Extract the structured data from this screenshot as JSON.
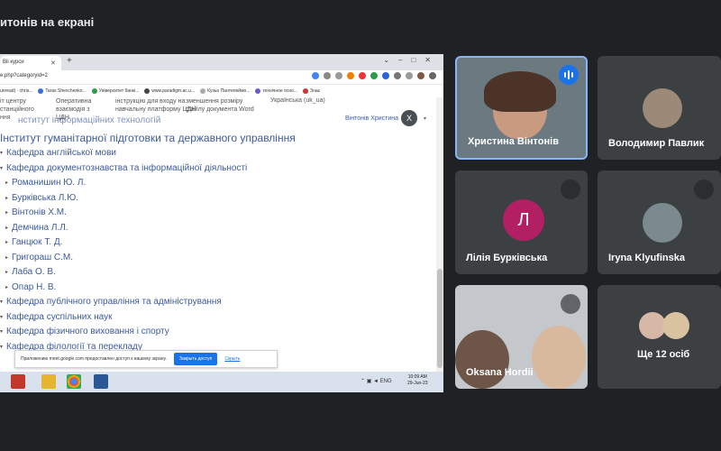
{
  "meeting": {
    "presenter_title": "итонів на екрані"
  },
  "shared_screen": {
    "browser": {
      "tab_title": "Віі курси",
      "url": "e.php?categoryid=2",
      "bookmarks": [
        "unread) · chris...",
        "Taras Shevchenko...",
        "Університет банкі...",
        "www.paradigm.ac.u...",
        "Кузьо Пантелеймо...",
        "технічное осно...",
        "Знає"
      ]
    },
    "page": {
      "overlap_lines": [
        [
          "іт центру",
          "станційного",
          "ння"
        ],
        [
          "Оперативна",
          "взаємодія з",
          "ЦДН"
        ],
        [
          "інструкцію для входу на",
          "навчальну платформу ЦДН"
        ],
        [
          "зменшення розміру",
          "файлу документа Word"
        ]
      ],
      "overlap_extra": "Українська (uk_ua)",
      "faded_heading": "нститут інформаційних технологій",
      "user_name": "Вінтонів Христина",
      "user_initial": "Х",
      "institute": "Інститут гуманітарної підготовки та державного управління",
      "tree": [
        {
          "label": "Кафедра англійської мови",
          "indent": 0
        },
        {
          "label": "Кафедра документознавства та інформаційної діяльності",
          "indent": 0
        },
        {
          "label": "Романишин Ю. Л.",
          "indent": 1
        },
        {
          "label": "Бурківська Л.Ю.",
          "indent": 1
        },
        {
          "label": "Вінтонів Х.М.",
          "indent": 1
        },
        {
          "label": "Демчина Л.Л.",
          "indent": 1
        },
        {
          "label": "Ганцюк Т. Д.",
          "indent": 1
        },
        {
          "label": "Григораш С.М.",
          "indent": 1
        },
        {
          "label": "Лаба О. В.",
          "indent": 1
        },
        {
          "label": "Опар Н. В.",
          "indent": 1
        },
        {
          "label": "Кафедра публічного управління та адміністрування",
          "indent": 0
        },
        {
          "label": "Кафедра суспільних наук",
          "indent": 0
        },
        {
          "label": "Кафедра фізичного виховання і спорту",
          "indent": 0
        },
        {
          "label": "Кафедра філології та перекладу",
          "indent": 0
        }
      ]
    },
    "notification": {
      "text": "Приложению meet.google.com предоставлен доступ к вашему экрану.",
      "stop_button": "Закрыть доступ",
      "hide_link": "Скрыть"
    },
    "taskbar": {
      "time": "10:09 AM",
      "date": "29-Jun-23"
    }
  },
  "participants": [
    {
      "name": "Христина Вінтонів",
      "speaking": true
    },
    {
      "name": "Володимир Павлик"
    },
    {
      "name": "Лілія Бурківська",
      "initial": "Л",
      "avatar_color": "#b31f63"
    },
    {
      "name": "Iryna Klyufinska"
    },
    {
      "name": "Oksana Hordii"
    },
    {
      "name": "Ще 12 осіб"
    }
  ],
  "colors": {
    "background": "#202124",
    "tile": "#3c4043",
    "accent": "#1a73e8",
    "link": "#3c5a9a"
  }
}
